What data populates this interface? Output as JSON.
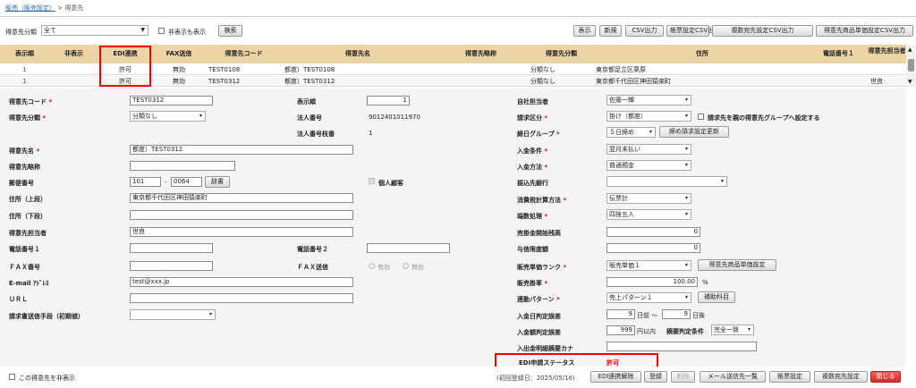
{
  "breadcrumb": {
    "link": "販売（販売設定）",
    "sep": ">",
    "current": "得意先"
  },
  "filter": {
    "group_label": "得意先分類",
    "group_value": "全て",
    "hidden_label": "非表示も表示",
    "search": "検索"
  },
  "toolbar": [
    "表示",
    "新規",
    "CSV出力",
    "帳票設定CSV出力",
    "複数宛先設定CSV出力",
    "得意先商品単価設定CSV出力"
  ],
  "table": {
    "headers": [
      "表示順",
      "非表示",
      "EDI連携",
      "FAX送信",
      "得意先コード",
      "得意先名",
      "得意先略称",
      "得意先分類",
      "住所",
      "電話番号１",
      "得意先担当者"
    ],
    "rows": [
      [
        "1",
        "",
        "許可",
        "無効",
        "TEST0108",
        "都度）TEST0108",
        "",
        "分類なし",
        "東京都足立区栗原",
        "",
        ""
      ],
      [
        "1",
        "",
        "許可",
        "無効",
        "TEST0312",
        "都度）TEST0312",
        "",
        "分類なし",
        "東京都千代田区神田猿楽町",
        "",
        "世良"
      ]
    ]
  },
  "form": {
    "left": [
      {
        "label": "得意先コード",
        "req": true,
        "value": "TEST0312"
      },
      {
        "label": "得意先分類",
        "req": true,
        "value": "分類なし"
      },
      {
        "label": "得意先名",
        "req": true,
        "value": "都度）TEST0312"
      },
      {
        "label": "得意先略称",
        "value": ""
      },
      {
        "label": "郵便番号",
        "zip1": "101",
        "zip_sep": "-",
        "zip2": "0064",
        "zip_btn": "辞書"
      },
      {
        "label": "住所（上段）",
        "value": "東京都千代田区神田猿楽町"
      },
      {
        "label": "住所（下段）",
        "value": ""
      },
      {
        "label": "得意先担当者",
        "value": "世良"
      },
      {
        "label": "電話番号１",
        "value": ""
      },
      {
        "label": "ＦＡＸ番号",
        "value": ""
      },
      {
        "label": "E-mail ｱﾄﾞﾚｽ",
        "value": "test@xxx.jp"
      },
      {
        "label": "ＵＲＬ",
        "value": ""
      },
      {
        "label": "請求書送信手段（初期値）",
        "value": ""
      }
    ],
    "mid": {
      "order_label": "表示順",
      "order_value": "1",
      "corp_label": "法人番号",
      "corp_value": "9012401011970",
      "branch_label": "法人番号枝番",
      "branch_value": "1",
      "individual_label": "個人顧客",
      "tel2_label": "電話番号２",
      "tel2_value": "",
      "fax_label": "ＦＡＸ送信",
      "fax_on": "有効",
      "fax_off": "無効"
    },
    "right": [
      {
        "label": "自社担当者",
        "value": "佐藤一輝"
      },
      {
        "label": "請求区分",
        "req": true,
        "value": "掛け（都度）",
        "extra": "請求先を親の得意先グループへ設定する"
      },
      {
        "label": "締日グループ",
        "req": true,
        "value": "５日締め",
        "btn": "締め請求設定更新"
      },
      {
        "label": "入金条件",
        "req": true,
        "value": "翌月末払い"
      },
      {
        "label": "入金方法",
        "req": true,
        "value": "普通預金"
      },
      {
        "label": "振込先銀行",
        "value": ""
      },
      {
        "label": "消費税計算方法",
        "req": true,
        "value": "伝票計"
      },
      {
        "label": "端数処理",
        "req": true,
        "value": "四捨五入"
      },
      {
        "label": "売掛金開始残高",
        "value": "0"
      },
      {
        "label": "与信限度額",
        "value": "0"
      },
      {
        "label": "販売単価ランク",
        "req": true,
        "value": "販売単価１",
        "btn": "得意先商品単価設定"
      },
      {
        "label": "販売掛率",
        "req": true,
        "value": "100.00",
        "unit": "%"
      },
      {
        "label": "連動パターン",
        "req": true,
        "value": "売上パターン１",
        "btn": "補助科目"
      },
      {
        "label": "入金日判定誤差",
        "v1": "9",
        "u1": "日前 〜",
        "v2": "9",
        "u2": "日後"
      },
      {
        "label": "入金額判定誤差",
        "value": "999",
        "unit": "円以内",
        "extra_label": "摘要判定条件",
        "extra_value": "完全一致"
      },
      {
        "label": "入出金明細摘要カナ",
        "value": ""
      },
      {
        "label": "EDI申請ステータス",
        "value": "許可"
      }
    ]
  },
  "footer": {
    "hide_label": "この得意先を非表示",
    "created": "(初回登録日：2025/05/16)",
    "buttons": [
      "EDI連携解除",
      "登録",
      "削除",
      "メール送信先一覧",
      "帳票設定",
      "複数宛先設定",
      "閉じる"
    ]
  }
}
